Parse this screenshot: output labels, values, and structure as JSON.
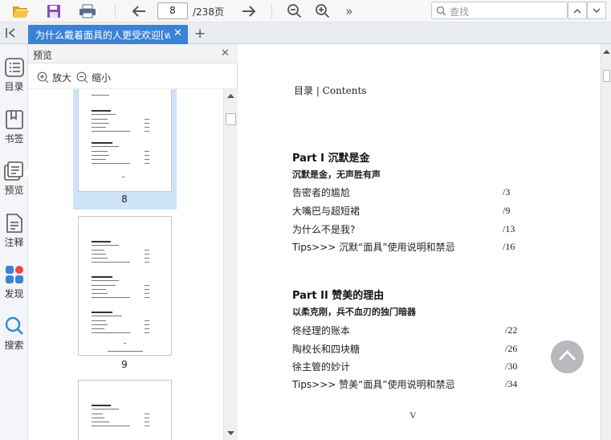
{
  "toolbar": {
    "page_current": "8",
    "page_total": "/238页",
    "icons": [
      "folder-open-icon",
      "save-icon",
      "print-icon",
      "back-arrow-icon",
      "page-input",
      "forward-arrow-icon",
      "zoom-out-icon",
      "zoom-in-icon",
      "more-icon"
    ],
    "search_placeholder": "查找"
  },
  "tabs": [
    {
      "label": "为什么戴着面具的人更受欢迎[w"
    }
  ],
  "sidebar": {
    "items": [
      {
        "label": "目录",
        "icon": "toc-icon"
      },
      {
        "label": "书签",
        "icon": "bookmark-icon"
      },
      {
        "label": "预览",
        "icon": "preview-icon"
      },
      {
        "label": "注释",
        "icon": "annotation-icon"
      },
      {
        "label": "发现",
        "icon": "discover-icon"
      },
      {
        "label": "搜索",
        "icon": "search-icon"
      }
    ]
  },
  "preview_panel": {
    "title": "预览",
    "zoom_in": "放大",
    "zoom_out": "缩小",
    "pages": [
      {
        "number": "8",
        "selected": true
      },
      {
        "number": "9",
        "selected": false
      },
      {
        "number": "",
        "selected": false
      }
    ]
  },
  "document": {
    "heading": "目录 | Contents",
    "sections": [
      {
        "part": "Part I  沉默是金",
        "motto": "沉默是金，无声胜有声",
        "entries": [
          {
            "title": "告密者的尴尬",
            "page": "/3"
          },
          {
            "title": "大嘴巴与超短裙",
            "page": "/9"
          },
          {
            "title": "为什么不是我?",
            "page": "/13"
          },
          {
            "title": "Tips>>> 沉默“面具”使用说明和禁忌",
            "page": "/16"
          }
        ]
      },
      {
        "part": "Part II  赞美的理由",
        "motto": "以柔克刚，兵不血刃的独门暗器",
        "entries": [
          {
            "title": "佟经理的账本",
            "page": "/22"
          },
          {
            "title": "陶校长和四块糖",
            "page": "/26"
          },
          {
            "title": "徐主管的妙计",
            "page": "/30"
          },
          {
            "title": "Tips>>> 赞美“面具”使用说明和禁忌",
            "page": "/34"
          }
        ]
      }
    ],
    "folio": "V"
  },
  "colors": {
    "accent": "#3a82d6",
    "selected_thumb": "#cfe3f8",
    "totop": "#b7b9bc"
  }
}
